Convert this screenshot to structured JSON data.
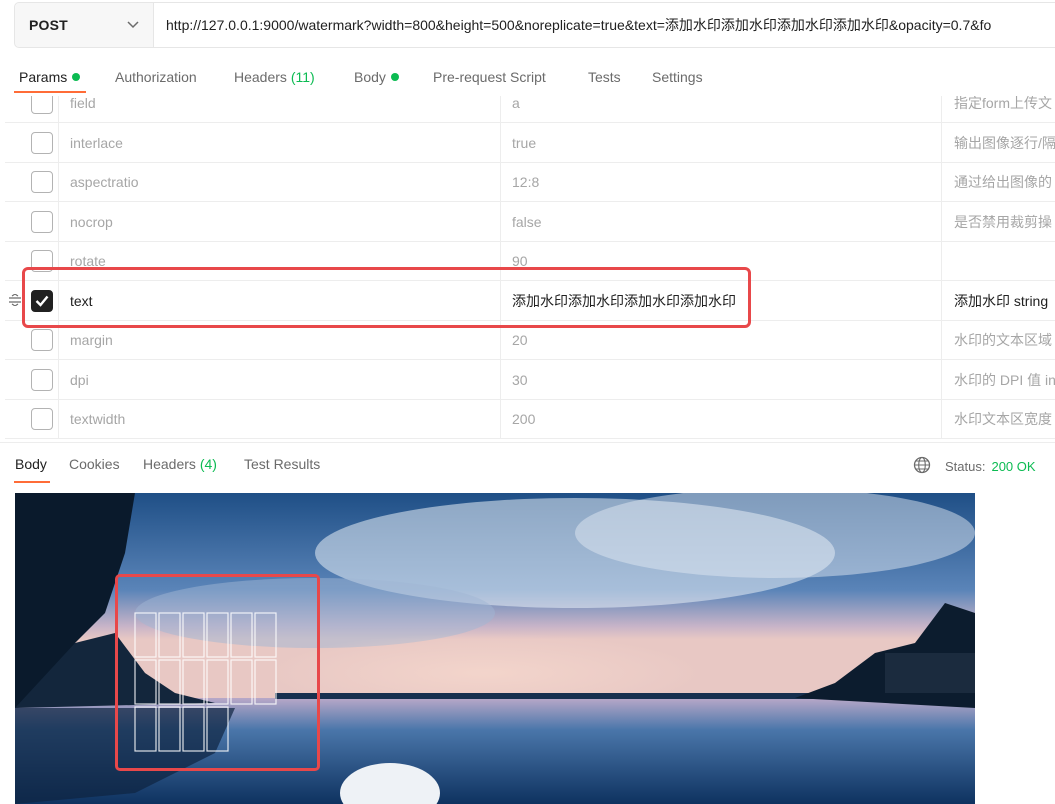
{
  "request": {
    "method": "POST",
    "url": "http://127.0.0.1:9000/watermark?width=800&height=500&noreplicate=true&text=添加水印添加水印添加水印添加水印&opacity=0.7&fo"
  },
  "request_tabs": [
    {
      "label": "Params",
      "dot": true,
      "active": true
    },
    {
      "label": "Authorization"
    },
    {
      "label": "Headers",
      "count": "(11)"
    },
    {
      "label": "Body",
      "dot": true
    },
    {
      "label": "Pre-request Script"
    },
    {
      "label": "Tests"
    },
    {
      "label": "Settings"
    }
  ],
  "params": [
    {
      "key": "field",
      "value": "a",
      "description": "指定form上传文",
      "checked": false
    },
    {
      "key": "interlace",
      "value": "true",
      "description": "输出图像逐行/隔",
      "checked": false
    },
    {
      "key": "aspectratio",
      "value": "12:8",
      "description": "通过给出图像的",
      "checked": false
    },
    {
      "key": "nocrop",
      "value": "false",
      "description": "是否禁用裁剪操",
      "checked": false
    },
    {
      "key": "rotate",
      "value": "90",
      "description": "",
      "checked": false
    },
    {
      "key": "text",
      "value": "添加水印添加水印添加水印添加水印",
      "description": "添加水印  string",
      "checked": true
    },
    {
      "key": "margin",
      "value": "20",
      "description": "水印的文本区域",
      "checked": false
    },
    {
      "key": "dpi",
      "value": "30",
      "description": "水印的 DPI 值 in",
      "checked": false
    },
    {
      "key": "textwidth",
      "value": "200",
      "description": "水印文本区宽度",
      "checked": false
    }
  ],
  "response_tabs": [
    {
      "label": "Body",
      "active": true
    },
    {
      "label": "Cookies"
    },
    {
      "label": "Headers",
      "count": "(4)"
    },
    {
      "label": "Test Results"
    }
  ],
  "status": {
    "label": "Status:",
    "code": "200 OK"
  },
  "colors": {
    "accent": "#ff6c37",
    "success": "#0cbb52",
    "highlight": "#e8484a"
  },
  "icons": [
    "chevron-down-icon",
    "drag-handle-icon",
    "check-icon",
    "globe-icon"
  ]
}
